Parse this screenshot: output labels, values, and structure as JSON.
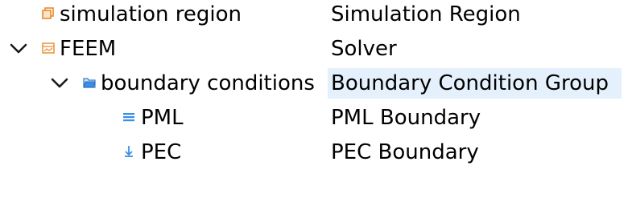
{
  "tree": {
    "rows": [
      {
        "name": "simulation region",
        "type": "Simulation Region",
        "icon": "simulation-region-icon",
        "expandable": false
      },
      {
        "name": "FEEM",
        "type": "Solver",
        "icon": "solver-icon",
        "expandable": true,
        "expanded": true
      },
      {
        "name": "boundary conditions",
        "type": "Boundary Condition Group",
        "icon": "folder-icon",
        "expandable": true,
        "expanded": true,
        "highlighted": true
      },
      {
        "name": "PML",
        "type": "PML Boundary",
        "icon": "pml-icon",
        "expandable": false
      },
      {
        "name": "PEC",
        "type": "PEC Boundary",
        "icon": "pec-icon",
        "expandable": false
      }
    ]
  },
  "colors": {
    "highlight": "#e4f0fb",
    "orange_icon": "#e8892b",
    "blue_icon": "#3a8ee6",
    "chevron": "#1a1a1a"
  }
}
